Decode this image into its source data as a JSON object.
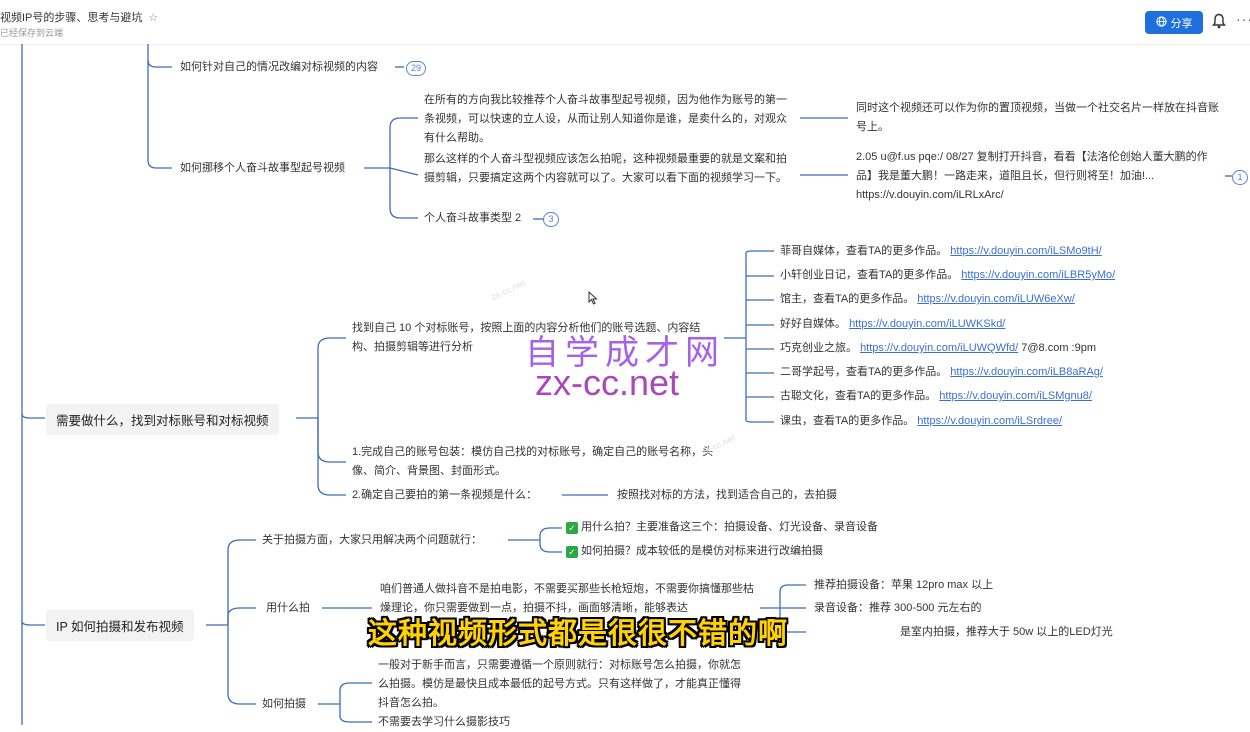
{
  "header": {
    "doc_title": "视频IP号的步骤、思考与避坑",
    "doc_status": "已经保存到云端",
    "share_label": "分享",
    "more_label": "···"
  },
  "branch1": {
    "label": "如何针对自己的情况改编对标视频的内容",
    "badge": "29"
  },
  "branch2": {
    "label": "如何挪移个人奋斗故事型起号视频",
    "para1": "在所有的方向我比较推荐个人奋斗故事型起号视频，因为他作为账号的第一条视频，可以快速的立人设，从而让别人知道你是谁，是卖什么的，对观众有什么帮助。",
    "para1_note": "同时这个视频还可以作为你的置顶视频，当做一个社交名片一样放在抖音账号上。",
    "para2": "那么这样的个人奋斗型视频应该怎么拍呢，这种视频最重要的就是文案和拍摄剪辑，只要搞定这两个内容就可以了。大家可以看下面的视频学习一下。",
    "para2_note": "2.05 u@f.us pqe:/ 08/27 复制打开抖音，看看【法洛伦创始人董大鹏的作品】我是董大鹏！一路走来，道阻且长，但行则将至！加油!... https://v.douyin.com/iLRLxArc/",
    "para2_badge": "1",
    "example": "个人奋斗故事类型 2",
    "example_badge": "3"
  },
  "main_node_1": {
    "label": "需要做什么，找到对标账号和对标视频",
    "find": "找到自己 10 个对标账号，按照上面的内容分析他们的账号选题、内容结构、拍摄剪辑等进行分析",
    "accounts": [
      {
        "name": "菲哥自媒体，查看TA的更多作品。",
        "url": "https://v.douyin.com/iLSMo9tH/",
        "extra": ""
      },
      {
        "name": "小轩创业日记，查看TA的更多作品。",
        "url": "https://v.douyin.com/iLBR5yMo/",
        "extra": ""
      },
      {
        "name": "馆主，查看TA的更多作品。",
        "url": "https://v.douyin.com/iLUW6eXw/",
        "extra": ""
      },
      {
        "name": "好好自媒体。",
        "url": "https://v.douyin.com/iLUWKSkd/",
        "extra": ""
      },
      {
        "name": "巧克创业之旅。",
        "url": "https://v.douyin.com/iLUWQWfd/",
        "extra": "7@8.com :9pm"
      },
      {
        "name": "二哥学起号，查看TA的更多作品。",
        "url": "https://v.douyin.com/iLB8aRAg/",
        "extra": ""
      },
      {
        "name": "古聪文化，查看TA的更多作品。",
        "url": "https://v.douyin.com/iLSMgnu8/",
        "extra": ""
      },
      {
        "name": "课虫，查看TA的更多作品。",
        "url": "https://v.douyin.com/iLSrdree/",
        "extra": ""
      }
    ],
    "step1": "1.完成自己的账号包装：模仿自己找的对标账号，确定自己的账号名称，头像、简介、背景图、封面形式。",
    "step2": "2.确定自己要拍的第一条视频是什么：",
    "step2_note": "按照找对标的方法，找到适合自己的，去拍摄"
  },
  "main_node_2": {
    "label": "IP 如何拍摄和发布视频",
    "shooting": "关于拍摄方面，大家只用解决两个问题就行：",
    "q1": "用什么拍？主要准备这三个：拍摄设备、灯光设备、录音设备",
    "q2": "如何拍摄？成本较低的是模仿对标来进行改编拍摄",
    "what_label": "用什么拍",
    "what_text": "咱们普通人做抖音不是拍电影，不需要买那些长枪短炮，不需要你搞懂那些枯燥理论，你只需要做到一点，拍摄不抖，画面够清晰，能够表达",
    "device1": "推荐拍摄设备：苹果 12pro max 以上",
    "device2": "录音设备：推荐 300-500 元左右的",
    "device3": "是室内拍摄，推荐大于 50w 以上的LED灯光",
    "how_label": "如何拍摄",
    "how_text": "一般对于新手而言，只需要遵循一个原则就行：对标账号怎么拍摄，你就怎么拍摄。模仿是最快且成本最低的起号方式。只有这样做了，才能真正懂得抖音怎么拍。",
    "how_text2": "不需要去学习什么摄影技巧"
  },
  "watermark": {
    "big": "自学成才网",
    "net": "zx-cc.net",
    "faint": "zx-cc.net"
  },
  "subtitle": "这种视频形式都是很很不错的啊"
}
